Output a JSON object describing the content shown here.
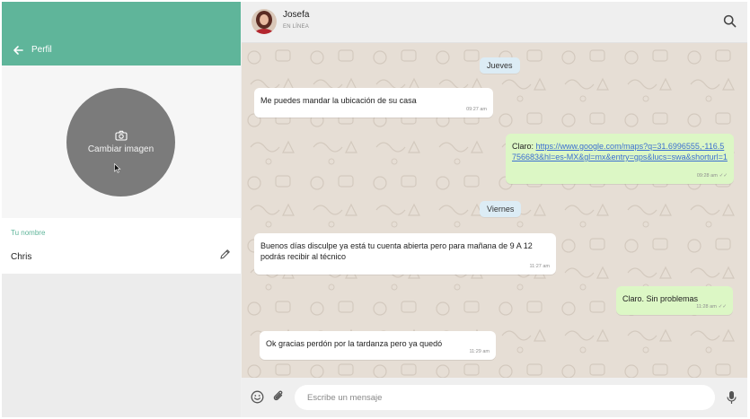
{
  "profile": {
    "title": "Perfil",
    "change_image_label": "Cambiar imagen",
    "name_label": "Tu nombre",
    "name_value": "Chris"
  },
  "contact": {
    "name": "Josefa",
    "status": "EN LÍNEA"
  },
  "messages": {
    "day_1": "Jueves",
    "m1": {
      "text": "Me puedes mandar la ubicación de su casa",
      "time": "09:27 am"
    },
    "m2": {
      "prefix": "Claro: ",
      "link": "https://www.google.com/maps?q=31.6996555,-116.5756683&hl=es-MX&gl=mx&entry=gps&lucs=swa&shorturl=1",
      "time": "09:28 am"
    },
    "day_2": "Viernes",
    "m3": {
      "text": "Buenos días disculpe ya está tu cuenta abierta pero para mañana de 9 A 12 podrás recibir al técnico",
      "time": "11:27 am"
    },
    "m4": {
      "text": "Claro. Sin problemas",
      "time": "11:28 am"
    },
    "m5": {
      "text": "Ok gracias perdón por la tardanza pero ya quedó",
      "time": "11:29 am"
    }
  },
  "compose": {
    "placeholder": "Escribe un mensaje"
  },
  "colors": {
    "accent": "#5fb59a",
    "outgoing_bubble": "#dcf7c5",
    "day_chip": "#dcecf5",
    "wallpaper": "#e6ded5"
  }
}
